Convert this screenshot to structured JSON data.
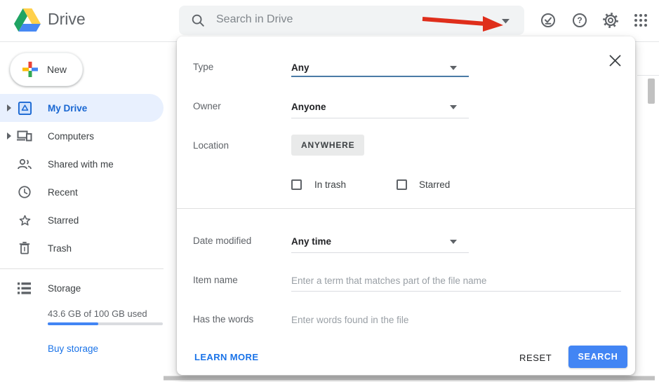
{
  "header": {
    "app_name": "Drive",
    "search_placeholder": "Search in Drive",
    "action_icons": [
      "offline-ready",
      "help",
      "settings",
      "google-apps"
    ]
  },
  "annotation": {
    "type": "red-arrow-pointing-to-search-options",
    "color": "#df2e1b"
  },
  "sidebar": {
    "new_label": "New",
    "items": [
      {
        "label": "My Drive",
        "active": true
      },
      {
        "label": "Computers",
        "active": false
      },
      {
        "label": "Shared with me",
        "active": false
      },
      {
        "label": "Recent",
        "active": false
      },
      {
        "label": "Starred",
        "active": false
      },
      {
        "label": "Trash",
        "active": false
      }
    ],
    "storage": {
      "label": "Storage",
      "usage_text": "43.6 GB of 100 GB used",
      "used_percent": 43.6,
      "buy_label": "Buy storage"
    }
  },
  "search_panel": {
    "type_label": "Type",
    "type_value": "Any",
    "owner_label": "Owner",
    "owner_value": "Anyone",
    "location_label": "Location",
    "location_value": "ANYWHERE",
    "in_trash_label": "In trash",
    "in_trash_checked": false,
    "starred_label": "Starred",
    "starred_checked": false,
    "date_modified_label": "Date modified",
    "date_modified_value": "Any time",
    "item_name_label": "Item name",
    "item_name_placeholder": "Enter a term that matches part of the file name",
    "has_words_label": "Has the words",
    "has_words_placeholder": "Enter words found in the file",
    "learn_more_label": "LEARN MORE",
    "reset_label": "RESET",
    "search_label": "SEARCH"
  },
  "colors": {
    "accent_blue": "#1a73e8",
    "search_button_blue": "#4285f4",
    "active_item_bg": "#e8f0fe",
    "active_item_text": "#1967d2",
    "focused_underline": "#4a7ba6",
    "searchbar_bg": "#f1f3f4"
  }
}
